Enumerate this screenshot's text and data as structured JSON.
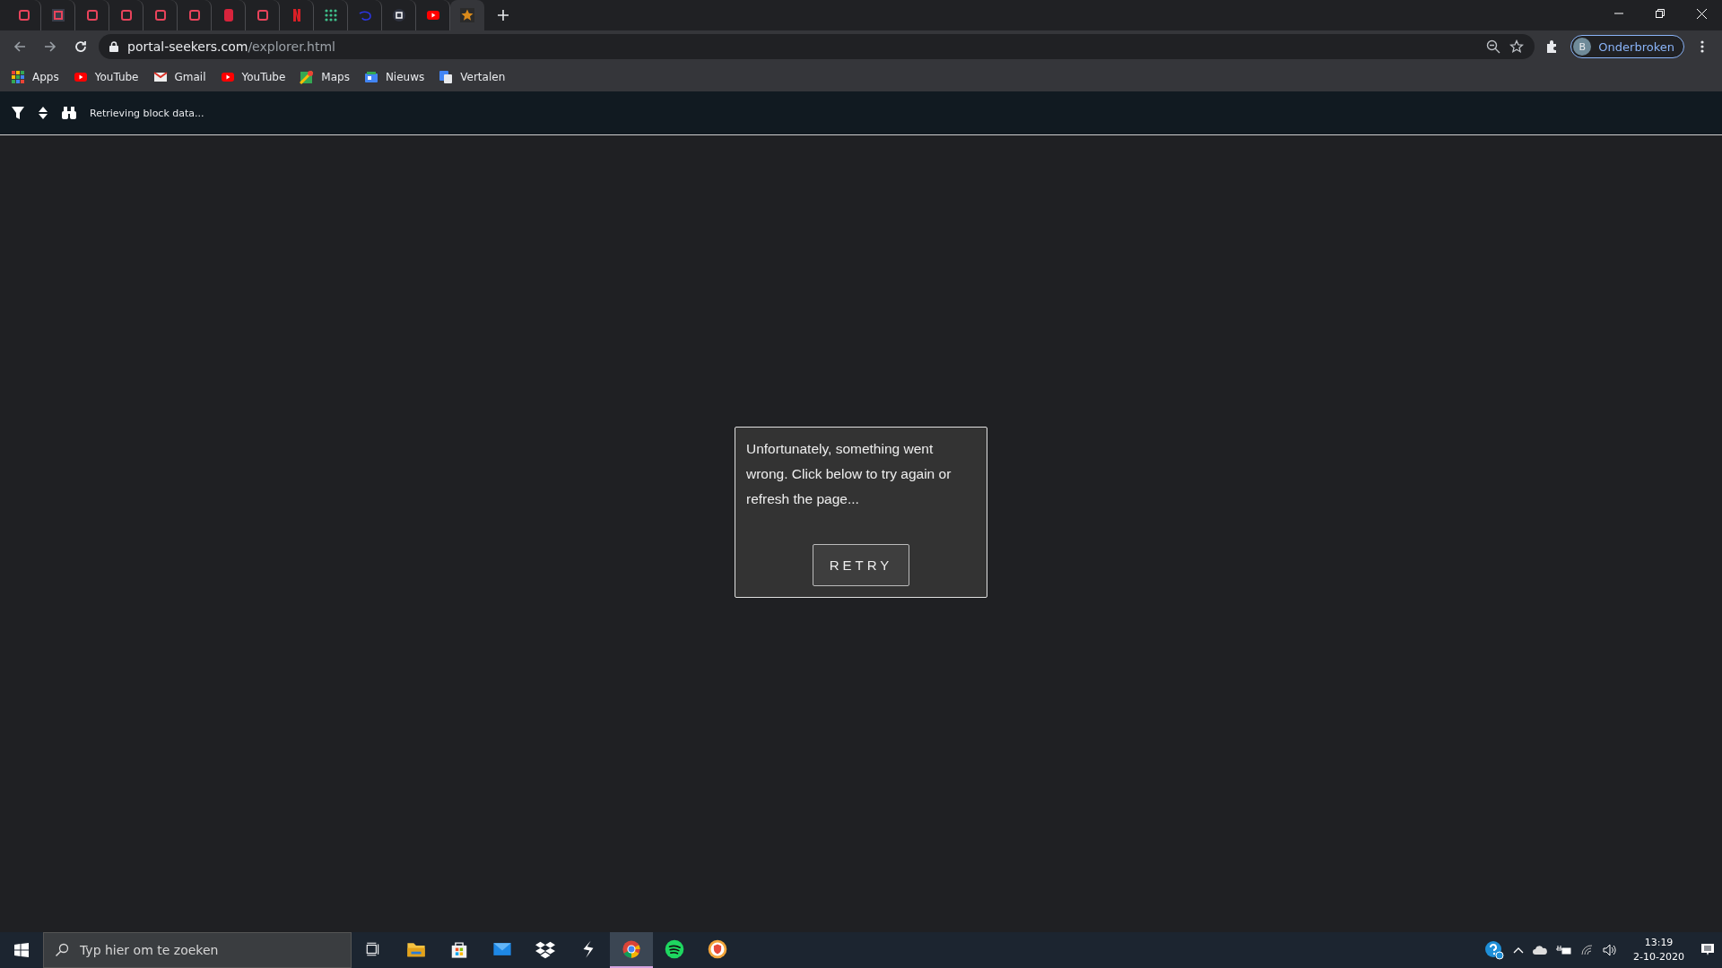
{
  "tabs": [
    {
      "kind": "pink",
      "selected": false
    },
    {
      "kind": "pink-boxed",
      "selected": false
    },
    {
      "kind": "pink",
      "selected": false
    },
    {
      "kind": "pink",
      "selected": false
    },
    {
      "kind": "pink",
      "selected": false
    },
    {
      "kind": "pink",
      "selected": false
    },
    {
      "kind": "red-bold",
      "selected": false
    },
    {
      "kind": "pink",
      "selected": false
    },
    {
      "kind": "red-stripe",
      "selected": false
    },
    {
      "kind": "dots",
      "selected": false
    },
    {
      "kind": "blue-swirl",
      "selected": false
    },
    {
      "kind": "round-dark",
      "selected": false
    },
    {
      "kind": "play",
      "selected": false
    },
    {
      "kind": "star",
      "selected": true
    }
  ],
  "address": {
    "domain": "portal-seekers.com",
    "path": "/explorer.html"
  },
  "profile": {
    "initial": "B",
    "label": "Onderbroken"
  },
  "bookmarks": [
    {
      "kind": "apps",
      "label": "Apps"
    },
    {
      "kind": "play",
      "label": "YouTube"
    },
    {
      "kind": "mail",
      "label": "Gmail"
    },
    {
      "kind": "play",
      "label": "YouTube"
    },
    {
      "kind": "map",
      "label": "Maps"
    },
    {
      "kind": "news",
      "label": "Nieuws"
    },
    {
      "kind": "translate",
      "label": "Vertalen"
    }
  ],
  "toolbar": {
    "status": "Retrieving block data..."
  },
  "dialog": {
    "message": "Unfortunately, something went wrong. Click below to try again or refresh the page...",
    "button": "RETRY"
  },
  "taskbar": {
    "search_placeholder": "Typ hier om te zoeken",
    "apps": [
      {
        "kind": "taskview",
        "selected": false
      },
      {
        "kind": "folder",
        "selected": false
      },
      {
        "kind": "store",
        "selected": false
      },
      {
        "kind": "mail",
        "selected": false
      },
      {
        "kind": "dropbox",
        "selected": false
      },
      {
        "kind": "bolt",
        "selected": false
      },
      {
        "kind": "chrome",
        "selected": true
      },
      {
        "kind": "spotify",
        "selected": false
      },
      {
        "kind": "shield",
        "selected": false
      }
    ],
    "time": "13:19",
    "date": "2-10-2020"
  }
}
